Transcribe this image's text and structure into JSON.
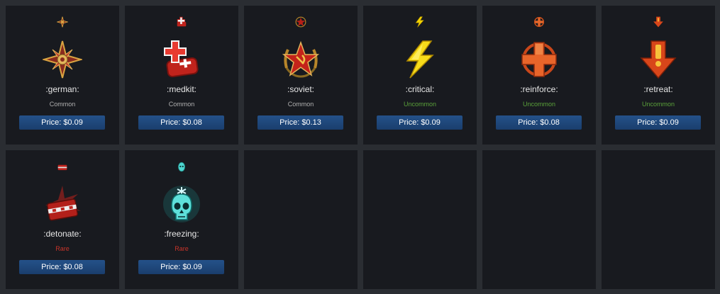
{
  "items": [
    {
      "name": ":german:",
      "rarity": "Common",
      "price": "Price: $0.09",
      "icon": "german-emblem-icon"
    },
    {
      "name": ":medkit:",
      "rarity": "Common",
      "price": "Price: $0.08",
      "icon": "medkit-icon"
    },
    {
      "name": ":soviet:",
      "rarity": "Common",
      "price": "Price: $0.13",
      "icon": "soviet-star-icon"
    },
    {
      "name": ":critical:",
      "rarity": "Uncommon",
      "price": "Price: $0.09",
      "icon": "lightning-bolt-icon"
    },
    {
      "name": ":reinforce:",
      "rarity": "Uncommon",
      "price": "Price: $0.08",
      "icon": "reinforce-cross-icon"
    },
    {
      "name": ":retreat:",
      "rarity": "Uncommon",
      "price": "Price: $0.09",
      "icon": "retreat-arrow-icon"
    },
    {
      "name": ":detonate:",
      "rarity": "Rare",
      "price": "Price: $0.08",
      "icon": "detonator-icon"
    },
    {
      "name": ":freezing:",
      "rarity": "Rare",
      "price": "Price: $0.09",
      "icon": "frozen-skull-icon"
    }
  ],
  "colors": {
    "common": "#b0b0b0",
    "uncommon": "#5aa13a",
    "rare": "#c8342a",
    "price_button": "#245189",
    "card_bg": "#181a1f",
    "page_bg": "#2a2d32"
  }
}
